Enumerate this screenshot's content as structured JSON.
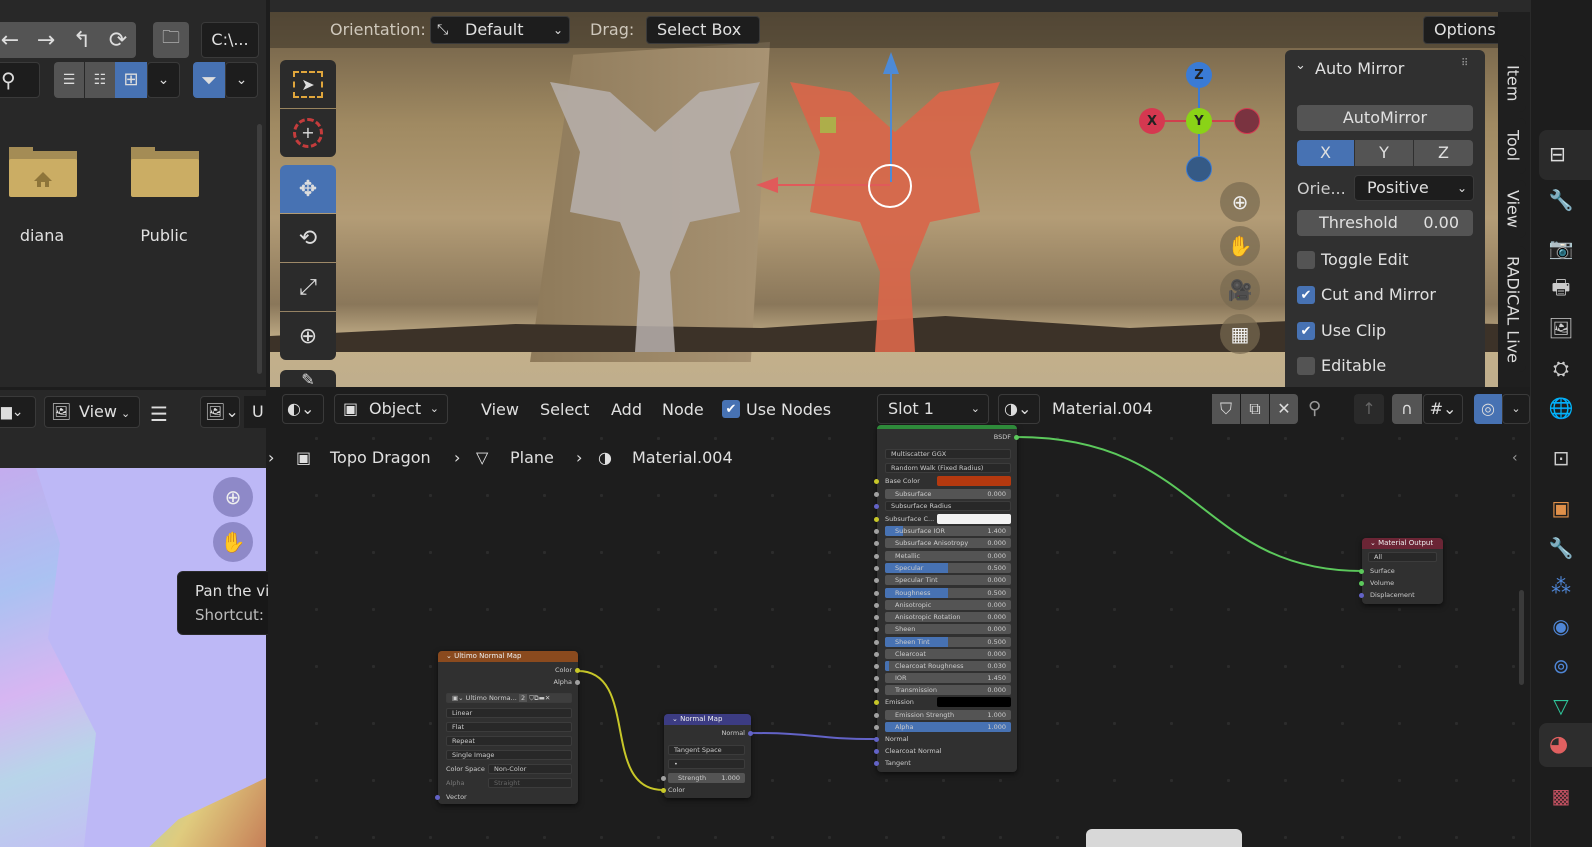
{
  "file_browser": {
    "nav_buttons": [
      "back-arrow-icon",
      "forward-arrow-icon",
      "parent-dir-icon",
      "refresh-icon"
    ],
    "path": "C:\\...",
    "folders": [
      {
        "name": "diana",
        "icon": "home-folder-icon"
      },
      {
        "name": "Public",
        "icon": "folder-icon"
      }
    ]
  },
  "viewport": {
    "orientation_label": "Orientation:",
    "orientation_value": "Default",
    "drag_label": "Drag:",
    "drag_value": "Select Box",
    "options_label": "Options",
    "tools": [
      "select-box",
      "cursor",
      "move",
      "rotate",
      "scale",
      "transform",
      "annotate"
    ],
    "active_tool": "move",
    "gizmo": {
      "z": "Z",
      "x": "X",
      "y": "Y"
    }
  },
  "n_panel": {
    "title": "Auto Mirror",
    "automirror_button": "AutoMirror",
    "axes": [
      "X",
      "Y",
      "Z"
    ],
    "active_axis": "X",
    "orientation_label": "Orie...",
    "orientation_value": "Positive",
    "threshold_label": "Threshold",
    "threshold_value": "0.00",
    "checkboxes": [
      {
        "label": "Toggle Edit",
        "checked": false
      },
      {
        "label": "Cut and Mirror",
        "checked": true
      },
      {
        "label": "Use Clip",
        "checked": true
      },
      {
        "label": "Editable",
        "checked": false
      }
    ],
    "tabs": [
      "Item",
      "Tool",
      "View",
      "RADiCAL Live"
    ]
  },
  "image_editor": {
    "view_menu": "View",
    "partial_label": "U",
    "tooltip_title": "Pan the view",
    "tooltip_shortcut": "Shortcut: Middle Mouse"
  },
  "node_editor": {
    "mode": "Object",
    "menus": [
      "View",
      "Select",
      "Add",
      "Node"
    ],
    "use_nodes_label": "Use Nodes",
    "use_nodes_checked": true,
    "slot": "Slot 1",
    "material": "Material.004",
    "breadcrumb": [
      "Topo Dragon",
      "Plane",
      "Material.004"
    ]
  },
  "nodes": {
    "image_node": {
      "title": "Ultimo Normal Map",
      "outputs": [
        "Color",
        "Alpha"
      ],
      "image_name": "Ultimo Norma...",
      "users": "2",
      "interpolation": "Linear",
      "projection": "Flat",
      "extension": "Repeat",
      "source": "Single Image",
      "color_space_label": "Color Space",
      "color_space": "Non-Color",
      "alpha_label": "Alpha",
      "alpha_mode": "Straight",
      "input": "Vector"
    },
    "normal_map": {
      "title": "Normal Map",
      "output": "Normal",
      "space": "Tangent Space",
      "uv": "•",
      "strength_label": "Strength",
      "strength": "1.000",
      "input": "Color"
    },
    "bsdf": {
      "output": "BSDF",
      "distribution": "Multiscatter GGX",
      "subsurface_method": "Random Walk (Fixed Radius)",
      "base_color_label": "Base Color",
      "base_color": "#b5390f",
      "subsurface_radius": "Subsurface Radius",
      "subsurface_color_label": "Subsurface C...",
      "subsurface_color": "#f2f2f2",
      "fields": [
        {
          "label": "Subsurface",
          "value": "0.000",
          "fill": 0
        },
        {
          "label": "Subsurface IOR",
          "value": "1.400",
          "fill": 0.14
        },
        {
          "label": "Subsurface Anisotropy",
          "value": "0.000",
          "fill": 0
        },
        {
          "label": "Metallic",
          "value": "0.000",
          "fill": 0
        },
        {
          "label": "Specular",
          "value": "0.500",
          "fill": 0.5
        },
        {
          "label": "Specular Tint",
          "value": "0.000",
          "fill": 0
        },
        {
          "label": "Roughness",
          "value": "0.500",
          "fill": 0.5
        },
        {
          "label": "Anisotropic",
          "value": "0.000",
          "fill": 0
        },
        {
          "label": "Anisotropic Rotation",
          "value": "0.000",
          "fill": 0
        },
        {
          "label": "Sheen",
          "value": "0.000",
          "fill": 0
        },
        {
          "label": "Sheen Tint",
          "value": "0.500",
          "fill": 0.5
        },
        {
          "label": "Clearcoat",
          "value": "0.000",
          "fill": 0
        },
        {
          "label": "Clearcoat Roughness",
          "value": "0.030",
          "fill": 0.03
        },
        {
          "label": "IOR",
          "value": "1.450",
          "fill": 0
        },
        {
          "label": "Transmission",
          "value": "0.000",
          "fill": 0
        }
      ],
      "emission_label": "Emission",
      "emission_color": "#000000",
      "emission_strength_label": "Emission Strength",
      "emission_strength": "1.000",
      "alpha_label": "Alpha",
      "alpha": "1.000",
      "inputs": [
        "Normal",
        "Clearcoat Normal",
        "Tangent"
      ]
    },
    "output": {
      "title": "Material Output",
      "target": "All",
      "inputs": [
        "Surface",
        "Volume",
        "Displacement"
      ]
    }
  },
  "colors": {
    "accent": "#4772b3",
    "image_header": "#8a4a1e",
    "normal_map_header": "#3c3c83",
    "output_header": "#6b2535",
    "link_green": "#5cc95c",
    "link_yellow": "#c7c729",
    "link_purple": "#6363c7"
  }
}
